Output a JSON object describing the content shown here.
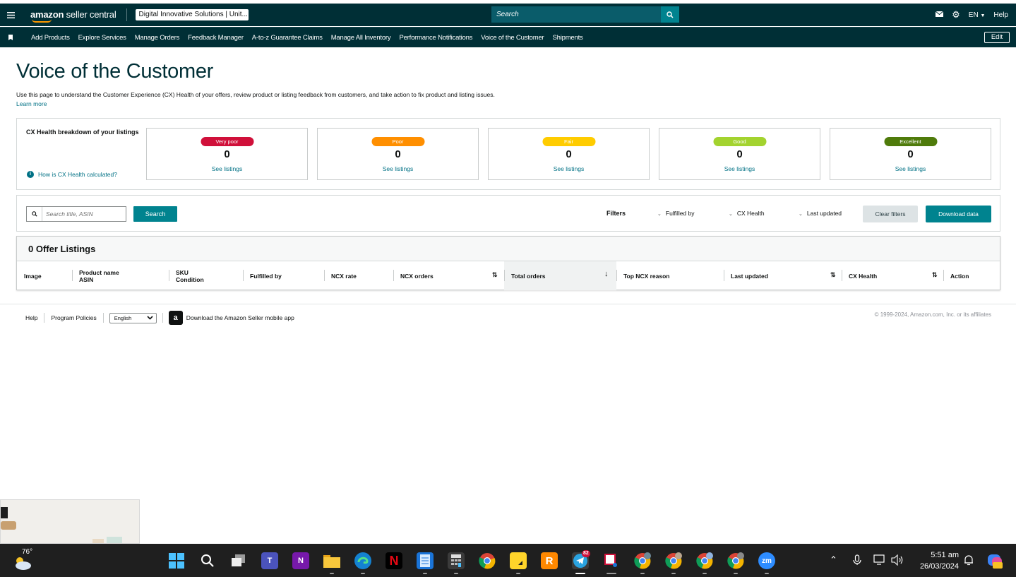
{
  "topbar": {
    "logo_amazon": "amazon",
    "logo_suffix": "seller central",
    "account": "Digital Innovative Solutions | Unit...",
    "search_placeholder": "Search",
    "language": "EN",
    "help": "Help"
  },
  "nav": {
    "items": [
      "Add Products",
      "Explore Services",
      "Manage Orders",
      "Feedback Manager",
      "A-to-z Guarantee Claims",
      "Manage All Inventory",
      "Performance Notifications",
      "Voice of the Customer",
      "Shipments"
    ],
    "edit": "Edit"
  },
  "page": {
    "title": "Voice of the Customer",
    "intro": "Use this page to understand the Customer Experience (CX) Health of your offers, review product or listing feedback from customers, and take action to fix product and listing issues.",
    "learn_more": "Learn more"
  },
  "health": {
    "title": "CX Health breakdown of your listings",
    "help": "How is CX Health calculated?",
    "help_icon": "info-icon",
    "cards": [
      {
        "label": "Very poor",
        "count": "0",
        "link": "See listings",
        "color": "#d0103a"
      },
      {
        "label": "Poor",
        "count": "0",
        "link": "See listings",
        "color": "#ff8f00"
      },
      {
        "label": "Fair",
        "count": "0",
        "link": "See listings",
        "color": "#ffcc00"
      },
      {
        "label": "Good",
        "count": "0",
        "link": "See listings",
        "color": "#a3d32f"
      },
      {
        "label": "Excellent",
        "count": "0",
        "link": "See listings",
        "color": "#4f7b0b"
      }
    ]
  },
  "filters": {
    "search_placeholder": "Search title, ASIN",
    "search_button": "Search",
    "label": "Filters",
    "dropdowns": [
      "Fulfilled by",
      "CX Health",
      "Last updated"
    ],
    "clear": "Clear filters",
    "download": "Download data"
  },
  "listings": {
    "title": "0 Offer Listings",
    "columns": [
      {
        "line1": "Image",
        "line2": ""
      },
      {
        "line1": "Product name",
        "line2": "ASIN"
      },
      {
        "line1": "SKU",
        "line2": "Condition"
      },
      {
        "line1": "Fulfilled by",
        "line2": ""
      },
      {
        "line1": "NCX rate",
        "line2": ""
      },
      {
        "line1": "NCX orders",
        "line2": ""
      },
      {
        "line1": "Total orders",
        "line2": ""
      },
      {
        "line1": "Top NCX reason",
        "line2": ""
      },
      {
        "line1": "Last updated",
        "line2": ""
      },
      {
        "line1": "CX Health",
        "line2": ""
      },
      {
        "line1": "Action",
        "line2": ""
      }
    ]
  },
  "footer": {
    "links": [
      "Help",
      "Program Policies"
    ],
    "language": "English",
    "app_text": "Download the Amazon Seller mobile app",
    "copyright": "© 1999-2024, Amazon.com, Inc. or its affiliates"
  },
  "taskbar": {
    "temperature": "76°",
    "badge": "82",
    "time": "5:51 am",
    "date": "26/03/2024"
  }
}
